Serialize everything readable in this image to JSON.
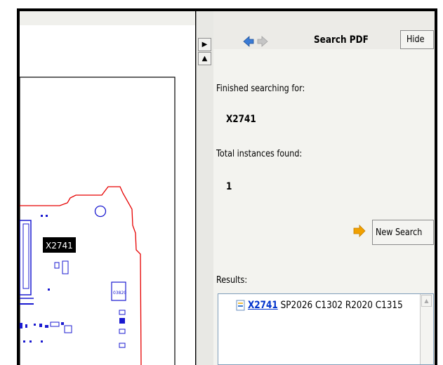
{
  "colors": {
    "accent_blue": "#3a7bd5",
    "link_blue": "#0033cc",
    "pcb_red": "#e60000",
    "pcb_blue": "#1a1ad0",
    "arrow_orange": "#f0a000"
  },
  "nav": {
    "back_icon": "left-arrow-icon",
    "forward_icon": "right-arrow-icon"
  },
  "panel": {
    "title": "Search PDF",
    "hide_label": "Hide",
    "finished_label": "Finished searching for:",
    "search_term": "X2741",
    "total_label": "Total instances found:",
    "total_count": "1",
    "new_search_label": "New Search",
    "results_label": "Results:",
    "results": [
      {
        "match": "X2741",
        "context": " SP2026 C1302 R2020 C1315"
      }
    ]
  },
  "pcb": {
    "highlight_label": "X2741",
    "chip_label": "03820"
  }
}
